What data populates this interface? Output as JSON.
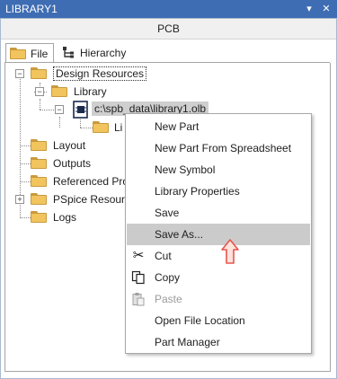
{
  "window": {
    "title": "LIBRARY1",
    "dropdown_glyph": "▾",
    "close_glyph": "✕"
  },
  "panel": {
    "header": "PCB"
  },
  "tabs": [
    {
      "label": "File",
      "active": true,
      "icon": "folder-icon"
    },
    {
      "label": "Hierarchy",
      "active": false,
      "icon": "hierarchy-icon"
    }
  ],
  "tree": {
    "design_resources": "Design Resources",
    "library": "Library",
    "library_file": "c:\\spb_data\\library1.olb",
    "library_file_child": "Li",
    "layout": "Layout",
    "outputs": "Outputs",
    "referenced": "Referenced Pro",
    "pspice": "PSpice Resource",
    "logs": "Logs",
    "expand_minus": "−",
    "expand_plus": "+"
  },
  "context_menu": {
    "items": [
      {
        "label": "New Part"
      },
      {
        "label": "New Part From Spreadsheet"
      },
      {
        "label": "New Symbol"
      },
      {
        "label": "Library Properties"
      },
      {
        "label": "Save"
      },
      {
        "label": "Save As...",
        "highlighted": true
      },
      {
        "label": "Cut",
        "icon": "scissors-icon",
        "glyph": "✂"
      },
      {
        "label": "Copy",
        "icon": "copy-icon"
      },
      {
        "label": "Paste",
        "icon": "paste-icon",
        "disabled": true
      },
      {
        "label": "Open File Location"
      },
      {
        "label": "Part Manager"
      }
    ]
  },
  "colors": {
    "titlebar": "#3e6db3",
    "highlight": "#cbcbcb",
    "folder": "#f1c45d",
    "arrow": "#e8554e"
  }
}
